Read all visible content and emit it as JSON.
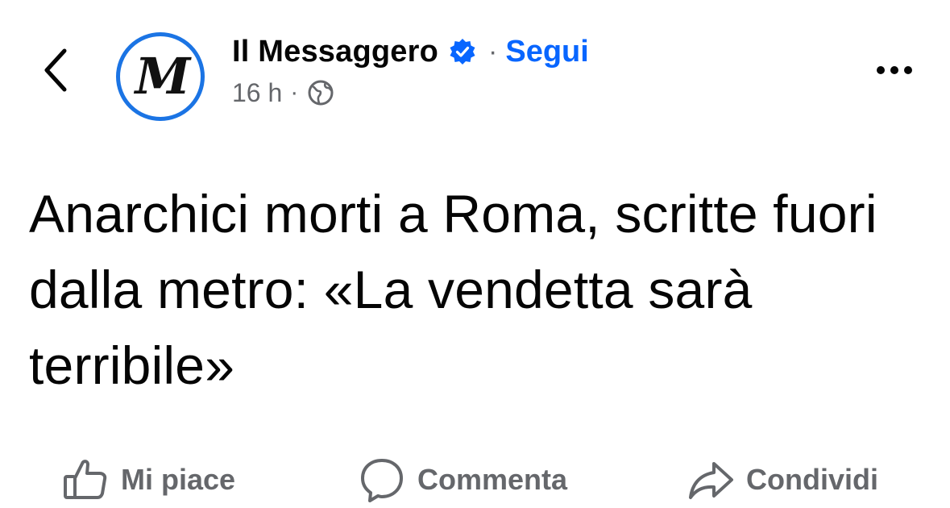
{
  "header": {
    "back_icon": "chevron-left-icon",
    "page_name": "Il Messaggero",
    "avatar_glyph": "M",
    "verified_icon": "verified-badge-icon",
    "separator": "·",
    "follow_label": "Segui",
    "time": "16 h",
    "meta_separator": "·",
    "privacy_icon": "globe-icon",
    "more_icon": "more-horizontal-icon"
  },
  "post": {
    "headline": "Anarchici morti a Roma, scritte fuori dalla metro: «La vendetta sarà terribile»"
  },
  "actions": [
    {
      "label": "Mi piace",
      "icon": "thumbs-up-icon"
    },
    {
      "label": "Commenta",
      "icon": "comment-icon"
    },
    {
      "label": "Condividi",
      "icon": "share-icon"
    }
  ],
  "colors": {
    "accent": "#0866ff",
    "avatar_ring": "#1b74e4",
    "secondary_text": "#65676b",
    "primary_text": "#050505",
    "background": "#ffffff"
  }
}
